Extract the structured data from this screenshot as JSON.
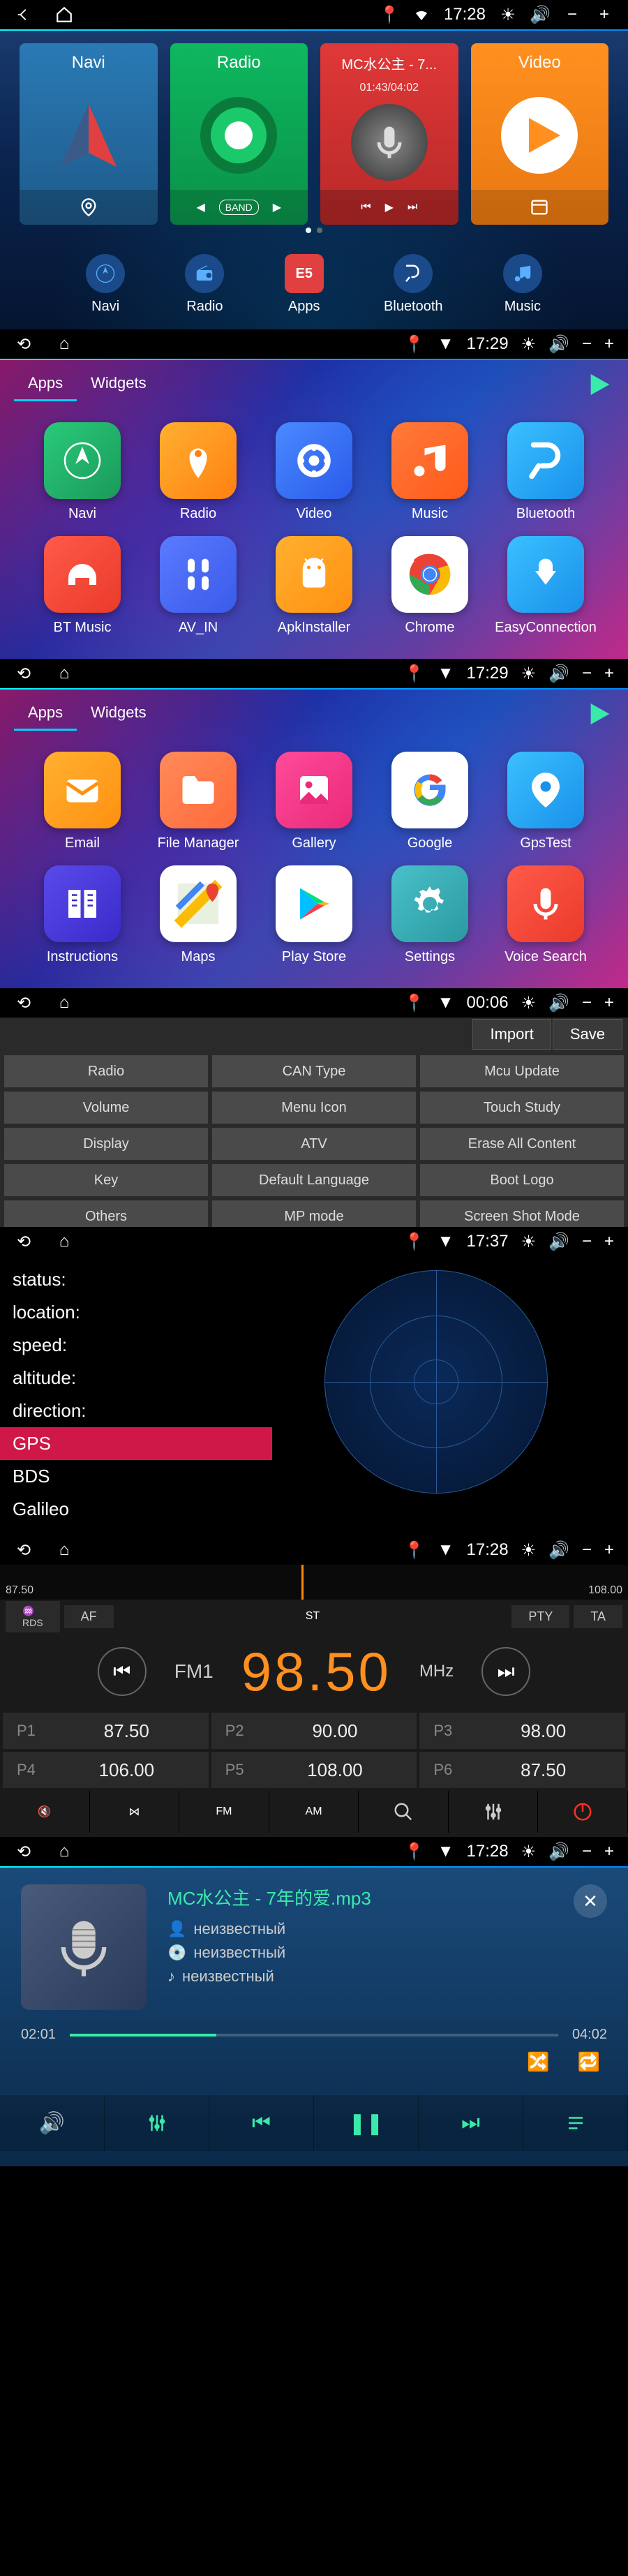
{
  "status_times": [
    "17:28",
    "17:29",
    "17:29",
    "00:06",
    "17:37",
    "17:28",
    "17:28"
  ],
  "s1": {
    "cards": {
      "navi": {
        "title": "Navi"
      },
      "radio": {
        "title": "Radio",
        "band": "BAND"
      },
      "music": {
        "title": "MC水公主 - 7...",
        "time": "01:43/04:02"
      },
      "video": {
        "title": "Video"
      }
    },
    "dock": [
      "Navi",
      "Radio",
      "Apps",
      "Bluetooth",
      "Music"
    ]
  },
  "apps": {
    "tabs": [
      "Apps",
      "Widgets"
    ],
    "page1": [
      "Navi",
      "Radio",
      "Video",
      "Music",
      "Bluetooth",
      "BT Music",
      "AV_IN",
      "ApkInstaller",
      "Chrome",
      "EasyConnection"
    ],
    "page2": [
      "Email",
      "File Manager",
      "Gallery",
      "Google",
      "GpsTest",
      "Instructions",
      "Maps",
      "Play Store",
      "Settings",
      "Voice Search"
    ]
  },
  "s4": {
    "import": "Import",
    "save": "Save",
    "cells": [
      "Radio",
      "CAN Type",
      "Mcu Update",
      "Volume",
      "Menu Icon",
      "Touch Study",
      "Display",
      "ATV",
      "Erase All Content",
      "Key",
      "Default Language",
      "Boot Logo",
      "Others",
      "MP mode",
      "Screen Shot Mode"
    ]
  },
  "s5": {
    "labels": [
      "status:",
      "location:",
      "speed:",
      "altitude:",
      "direction:"
    ],
    "sats": [
      "GPS",
      "BDS",
      "Galileo"
    ]
  },
  "s6": {
    "scale_left": "87.50",
    "scale_right": "108.00",
    "fn": [
      "AF",
      "ST",
      "PTY",
      "TA"
    ],
    "band": "FM1",
    "freq": "98.50",
    "unit": "MHz",
    "presets": [
      {
        "n": "P1",
        "v": "87.50"
      },
      {
        "n": "P2",
        "v": "90.00"
      },
      {
        "n": "P3",
        "v": "98.00"
      },
      {
        "n": "P4",
        "v": "106.00"
      },
      {
        "n": "P5",
        "v": "108.00"
      },
      {
        "n": "P6",
        "v": "87.50"
      }
    ],
    "bottom": [
      "FM",
      "AM"
    ]
  },
  "s7": {
    "song": "MC水公主 - 7年的爱.mp3",
    "meta": [
      "неизвестный",
      "неизвестный",
      "неизвестный"
    ],
    "elapsed": "02:01",
    "total": "04:02"
  }
}
